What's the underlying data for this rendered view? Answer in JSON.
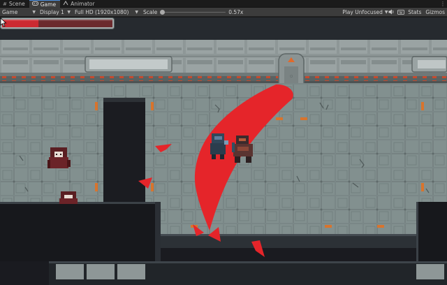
{
  "editor": {
    "tabs": [
      {
        "label": "Scene",
        "icon": "scene-grid-icon",
        "active": false
      },
      {
        "label": "Game",
        "icon": "gamepad-icon",
        "active": true
      },
      {
        "label": "Animator",
        "icon": "animator-icon",
        "active": false
      }
    ],
    "toolbar": {
      "view_mode": "Game",
      "display": "Display 1",
      "resolution": "Full HD (1920x1080)",
      "scale_label": "Scale",
      "scale_value": "0.57x",
      "scale_level": 0.0,
      "play_mode": "Play Unfocused",
      "icons": [
        "audio-speaker-icon",
        "keyboard-icon"
      ],
      "stats_label": "Stats",
      "gizmos_label": "Gizmos"
    }
  },
  "game": {
    "player_health_fraction": 0.33,
    "colors": {
      "health_fill": "#cc2a31",
      "health_empty": "#6b2a2d",
      "slash": "#e5252a",
      "floor": "#7d8a8a",
      "wall_panel": "#8d9696",
      "void": "#1b1c21",
      "accent_light": "#e05a2a"
    }
  }
}
